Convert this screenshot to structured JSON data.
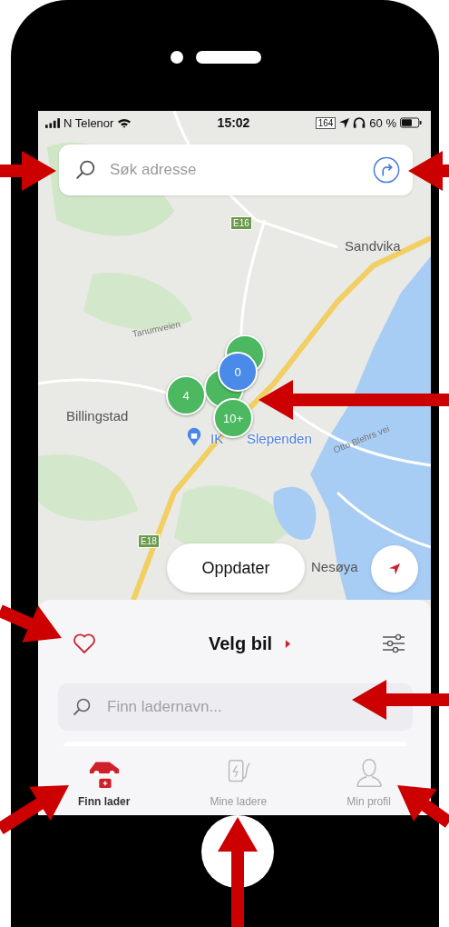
{
  "status_bar": {
    "carrier": "N Telenor",
    "time": "15:02",
    "road_sign": "164",
    "battery": "60 %"
  },
  "search": {
    "placeholder": "Søk adresse"
  },
  "map": {
    "labels": [
      {
        "text": "E16",
        "kind": "shield"
      },
      {
        "text": "Sandvika",
        "kind": "place"
      },
      {
        "text": "Tanumveien",
        "kind": "road"
      },
      {
        "text": "Billingstad",
        "kind": "place"
      },
      {
        "text": "IK",
        "kind": "poi"
      },
      {
        "text": "Slependen",
        "kind": "poi"
      },
      {
        "text": "Otto Blehrs vei",
        "kind": "road"
      },
      {
        "text": "E18",
        "kind": "shield"
      },
      {
        "text": "Nesøya",
        "kind": "place"
      }
    ],
    "markers": [
      {
        "label": "4",
        "color": "#4cb860"
      },
      {
        "label": "0",
        "color": "#4a8ae8"
      },
      {
        "label": "10+",
        "color": "#4cb860"
      }
    ]
  },
  "update_button": "Oppdater",
  "panel": {
    "title": "Velg bil",
    "search_placeholder": "Finn ladernavn..."
  },
  "tabs": [
    {
      "label": "Finn lader",
      "selected": true
    },
    {
      "label": "Mine ladere",
      "selected": false
    },
    {
      "label": "Min profil",
      "selected": false
    }
  ]
}
